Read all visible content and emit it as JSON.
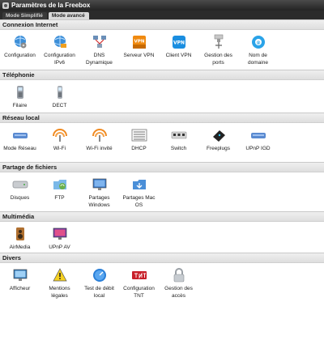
{
  "window": {
    "title": "Paramètres de la Freebox"
  },
  "modes": [
    {
      "label": "Mode Simplifié"
    },
    {
      "label": "Mode avancé"
    }
  ],
  "sections": [
    {
      "title": "Connexion Internet",
      "items": [
        {
          "label": "Configuration",
          "icon": "globe-gear-icon"
        },
        {
          "label": "Configuration IPv6",
          "icon": "globe-ipv6-icon"
        },
        {
          "label": "DNS Dynamique",
          "icon": "dns-network-icon"
        },
        {
          "label": "Serveur VPN",
          "icon": "vpn-server-icon"
        },
        {
          "label": "Client VPN",
          "icon": "vpn-client-icon"
        },
        {
          "label": "Gestion des ports",
          "icon": "port-forwarding-icon"
        },
        {
          "label": "Nom de domaine",
          "icon": "domain-name-icon"
        }
      ]
    },
    {
      "title": "Téléphonie",
      "items": [
        {
          "label": "Filaire",
          "icon": "desk-phone-icon"
        },
        {
          "label": "DECT",
          "icon": "dect-phone-icon"
        }
      ]
    },
    {
      "title": "Réseau local",
      "items": [
        {
          "label": "Mode Réseau",
          "icon": "router-icon"
        },
        {
          "label": "Wi-Fi",
          "icon": "wifi-icon"
        },
        {
          "label": "Wi-Fi invité",
          "icon": "wifi-guest-icon"
        },
        {
          "label": "DHCP",
          "icon": "dhcp-list-icon"
        },
        {
          "label": "Switch",
          "icon": "switch-icon"
        },
        {
          "label": "Freeplugs",
          "icon": "freeplug-icon"
        },
        {
          "label": "UPnP IGD",
          "icon": "upnp-igd-icon"
        }
      ]
    },
    {
      "title": "Partage de fichiers",
      "items": [
        {
          "label": "Disques",
          "icon": "hard-disk-icon"
        },
        {
          "label": "FTP",
          "icon": "ftp-folder-icon"
        },
        {
          "label": "Partages Windows",
          "icon": "windows-share-icon"
        },
        {
          "label": "Partages Mac OS",
          "icon": "macos-share-icon"
        }
      ]
    },
    {
      "title": "Multimédia",
      "items": [
        {
          "label": "AirMedia",
          "icon": "speaker-icon"
        },
        {
          "label": "UPnP AV",
          "icon": "upnp-av-icon"
        }
      ]
    },
    {
      "title": "Divers",
      "items": [
        {
          "label": "Afficheur",
          "icon": "display-icon"
        },
        {
          "label": "Mentions légales",
          "icon": "warning-icon"
        },
        {
          "label": "Test de débit local",
          "icon": "speed-test-icon"
        },
        {
          "label": "Configuration TNT",
          "icon": "tnt-icon"
        },
        {
          "label": "Gestion des accès",
          "icon": "padlock-icon"
        }
      ]
    }
  ]
}
